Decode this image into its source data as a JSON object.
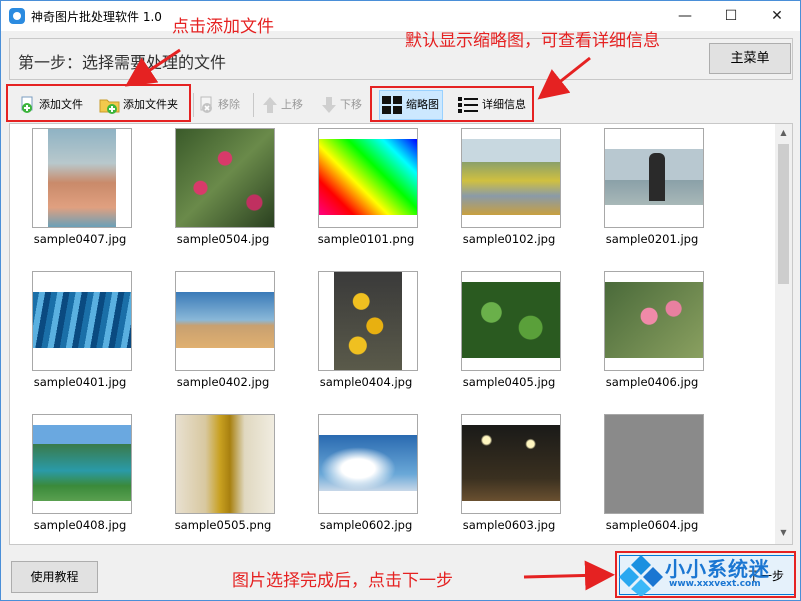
{
  "window": {
    "title": "神奇图片批处理软件 1.0",
    "minimize": "—",
    "maximize": "☐",
    "close": "✕"
  },
  "step": {
    "text": "第一步：选择需要处理的文件",
    "menu_button": "主菜单"
  },
  "toolbar": {
    "add_file": "添加文件",
    "add_folder": "添加文件夹",
    "remove": "移除",
    "move_up": "上移",
    "move_down": "下移",
    "thumbnails": "缩略图",
    "details": "详细信息"
  },
  "files": [
    "sample0407.jpg",
    "sample0504.jpg",
    "sample0101.png",
    "sample0102.jpg",
    "sample0201.jpg",
    "sample0401.jpg",
    "sample0402.jpg",
    "sample0404.jpg",
    "sample0405.jpg",
    "sample0406.jpg",
    "sample0408.jpg",
    "sample0505.png",
    "sample0602.jpg",
    "sample0603.jpg",
    "sample0604.jpg"
  ],
  "bottom": {
    "help_button": "使用教程",
    "next_button": "下一步"
  },
  "watermark": {
    "name": "小小系统迷",
    "url": "www.xxxvext.com"
  },
  "annotations": {
    "add_file_hint": "点击添加文件",
    "view_hint": "默认显示缩略图，可查看详细信息",
    "next_hint": "图片选择完成后，点击下一步"
  },
  "colors": {
    "annotation": "#e52222",
    "accent": "#0078d7"
  }
}
